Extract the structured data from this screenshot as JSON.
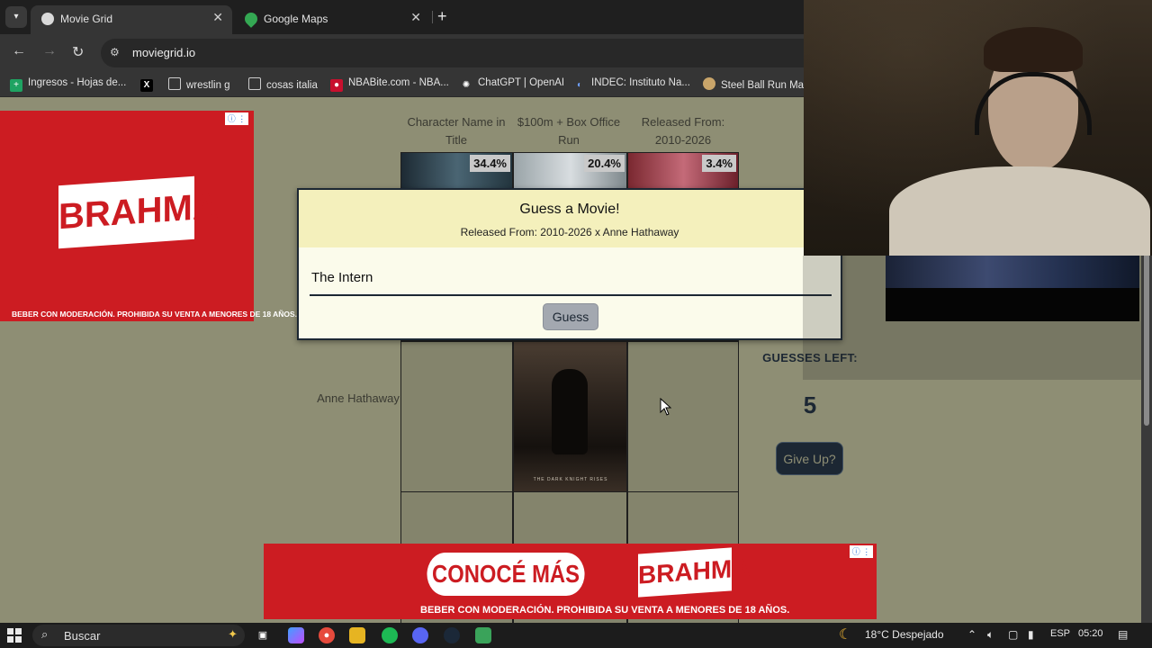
{
  "browser": {
    "tabs": [
      {
        "label": "Movie Grid",
        "active": true
      },
      {
        "label": "Google Maps",
        "active": false
      }
    ],
    "url": "moviegrid.io",
    "bookmarks": [
      "Ingresos - Hojas de...",
      "",
      "wrestlin g",
      "cosas italia",
      "NBABite.com - NBA...",
      "ChatGPT | OpenAI",
      "INDEC: Instituto Na...",
      "Steel Ball Run Man"
    ]
  },
  "ads": {
    "brand": "BRAHMA",
    "disclaimer": "BEBER CON MODERACIÓN. PROHIBIDA SU VENTA A MENORES DE 18 AÑOS.",
    "cta": "CONOCÉ MÁS"
  },
  "grid": {
    "columns": [
      {
        "header": "Character Name in Title",
        "percent": "34.4%"
      },
      {
        "header": "$100m + Box Office Run",
        "percent": "20.4%"
      },
      {
        "header": "Released From: 2010-2026",
        "percent": "3.4%"
      }
    ],
    "rows": [
      {
        "label": "Anne Hathaway"
      }
    ],
    "poster_caption": "THE DARK KNIGHT RISES"
  },
  "sidebar": {
    "guesses_left_label": "GUESSES LEFT:",
    "guesses_left": "5",
    "give_up_label": "Give Up?"
  },
  "modal": {
    "title": "Guess a Movie!",
    "subtitle": "Released From: 2010-2026 x Anne Hathaway",
    "input_value": "The Intern",
    "button_label": "Guess"
  },
  "taskbar": {
    "search_label": "Buscar",
    "weather": "18°C  Despejado",
    "language": "ESP",
    "time": "05:20"
  }
}
